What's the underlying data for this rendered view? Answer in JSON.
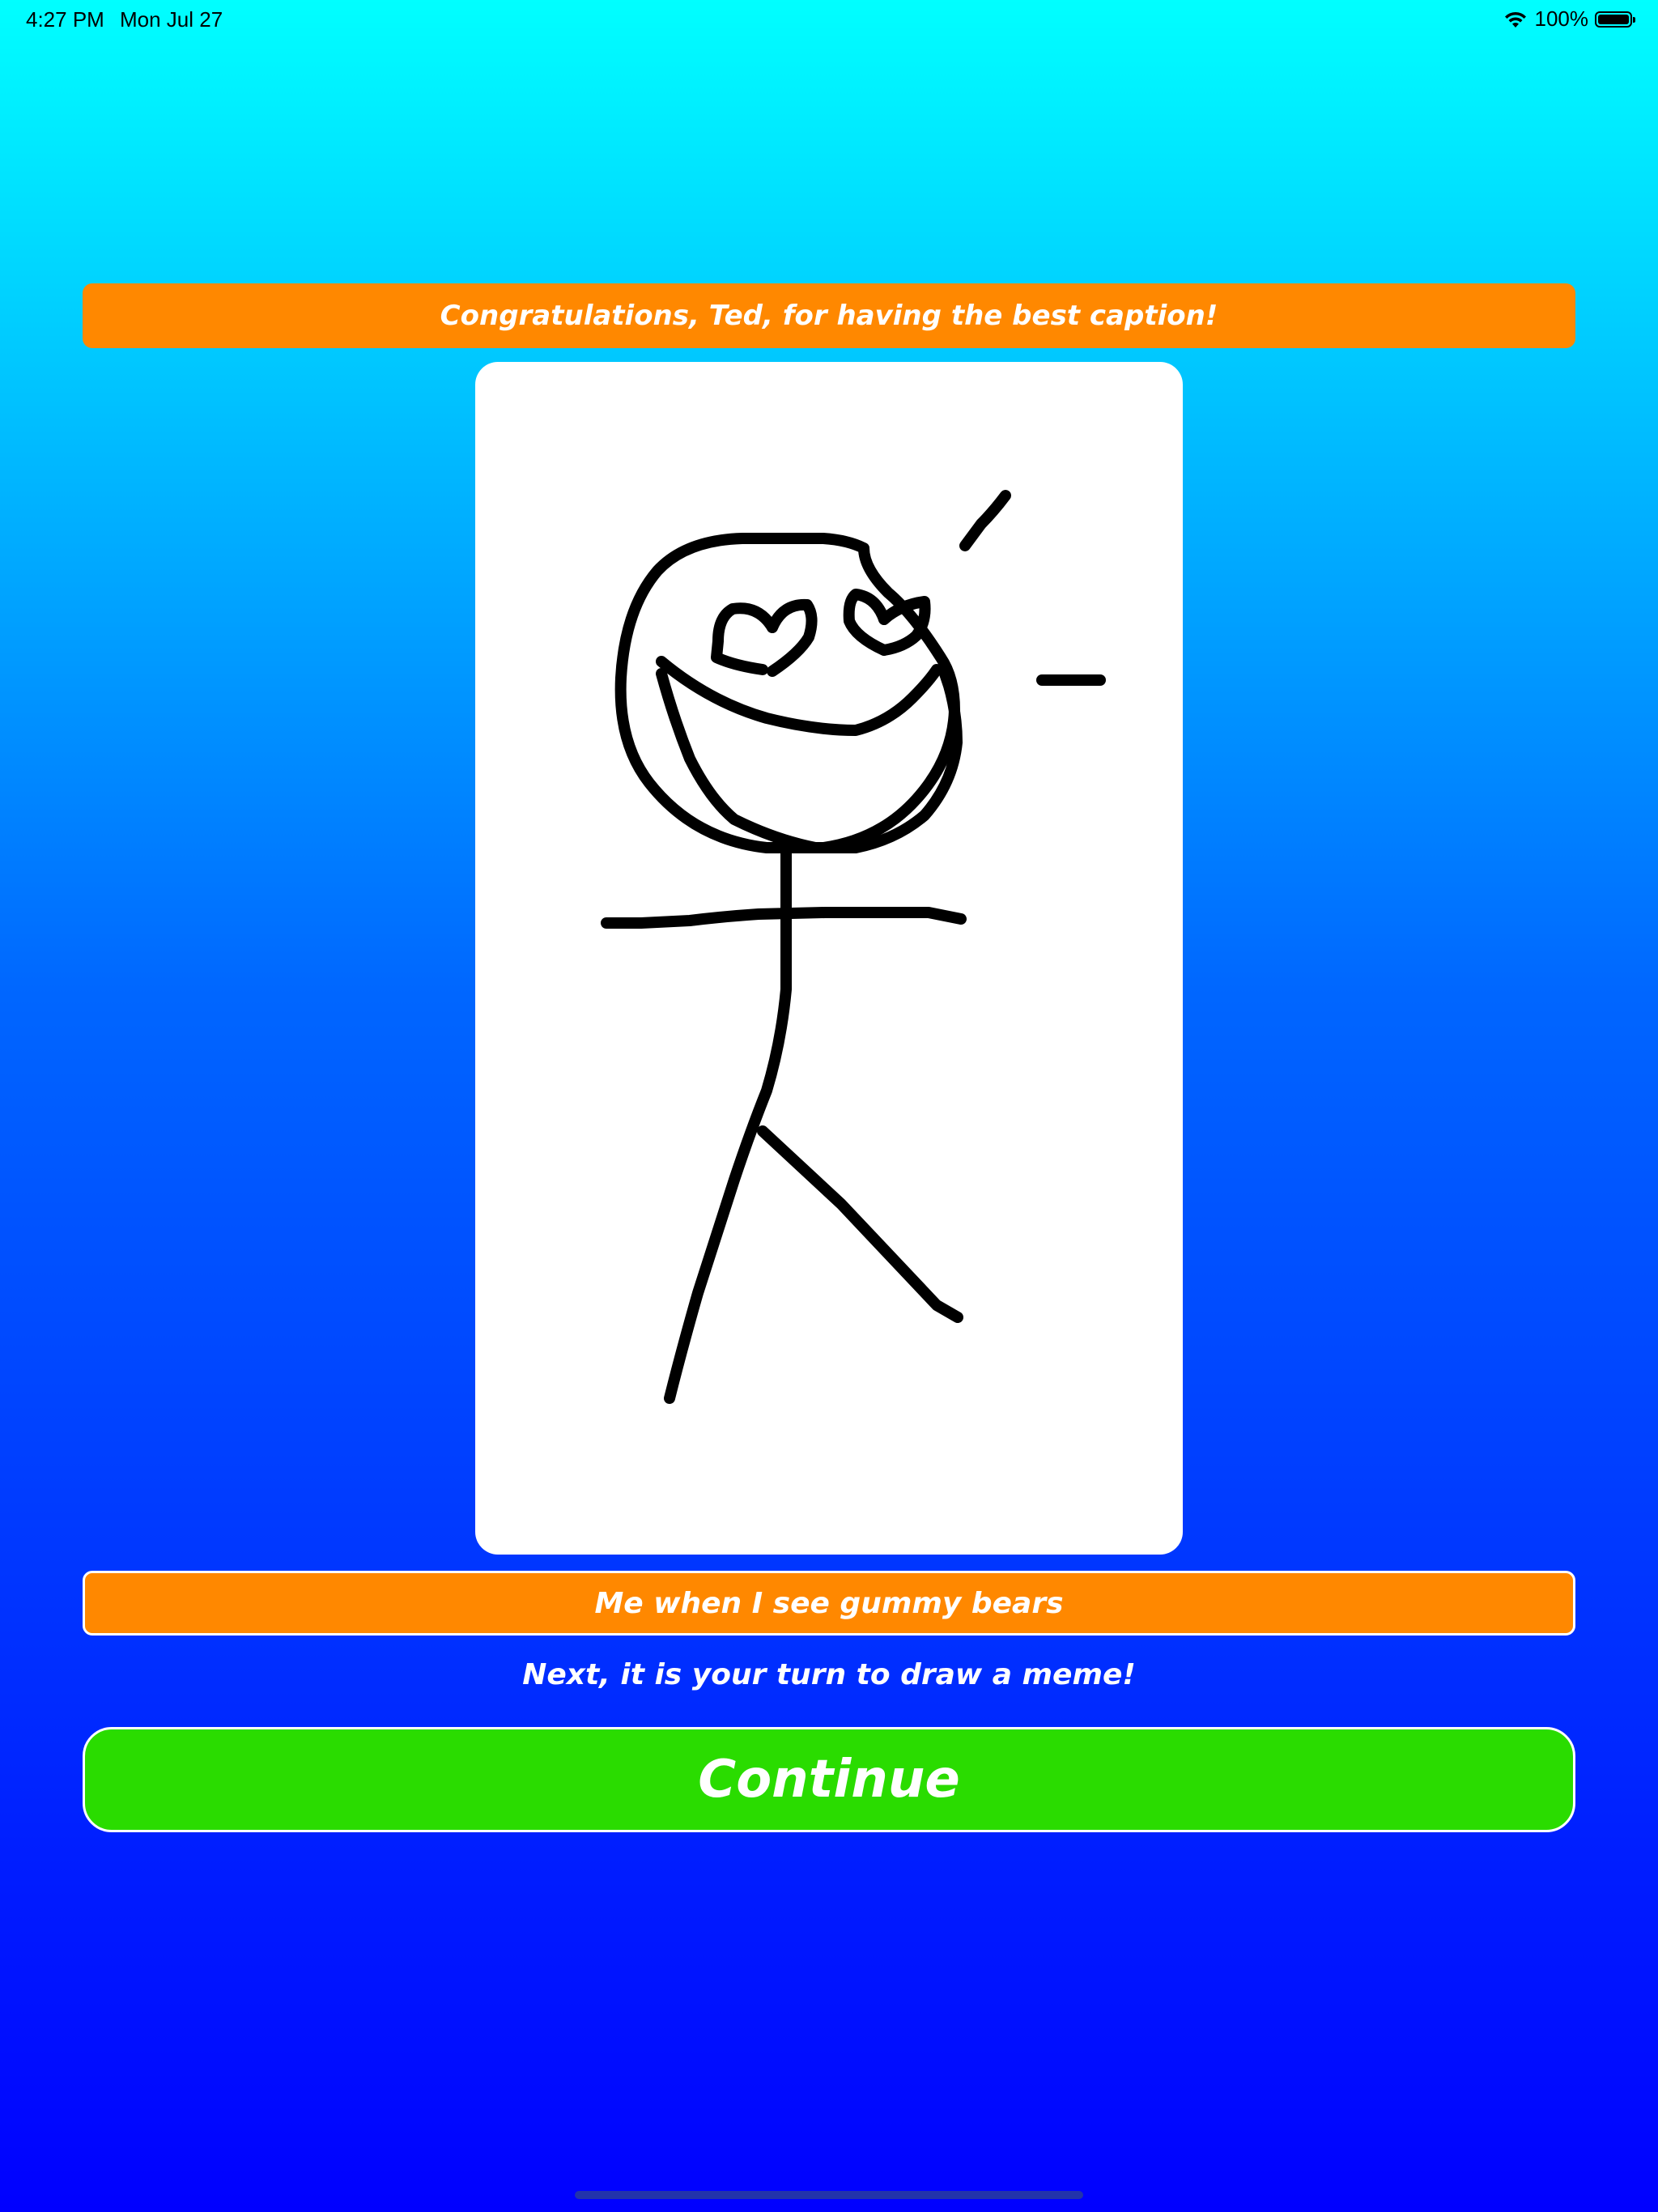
{
  "status_bar": {
    "time": "4:27 PM",
    "date": "Mon Jul 27",
    "battery": "100%",
    "icons": [
      "wifi-icon",
      "battery-icon"
    ]
  },
  "winner_banner": {
    "text": "Congratulations, Ted, for having the best caption!"
  },
  "drawing": {
    "description_icon": "stick-figure-drawing"
  },
  "caption_banner": {
    "text": "Me when I see gummy bears"
  },
  "next_message": "Next, it is your turn to draw a meme!",
  "continue_button": {
    "label": "Continue"
  },
  "colors": {
    "background_top": "#00ffff",
    "background_bottom": "#0000ff",
    "banner": "#ff8800",
    "button": "#2adc00",
    "text": "#ffffff"
  }
}
